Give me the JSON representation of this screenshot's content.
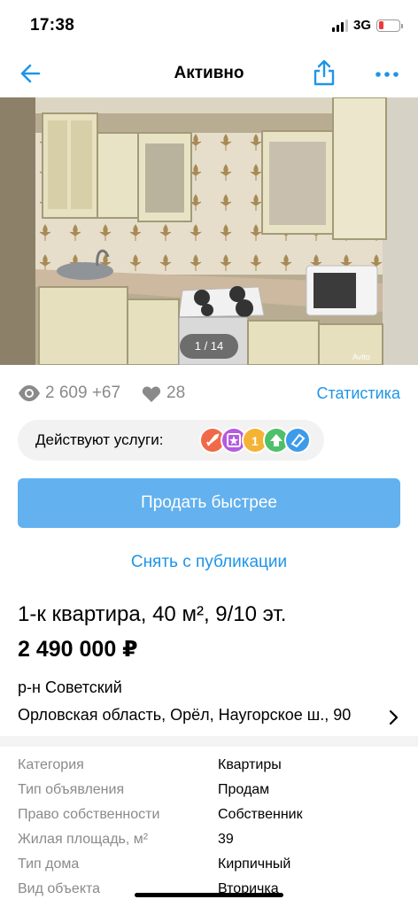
{
  "status": {
    "time": "17:38",
    "network": "3G",
    "battery_color": "#f0383e"
  },
  "nav": {
    "title": "Активно",
    "back_icon": "arrow-left-icon",
    "share_icon": "share-icon",
    "more_icon": "more-dots-icon"
  },
  "photo": {
    "counter": "1 / 14",
    "watermark": "Avito"
  },
  "stats": {
    "views": "2 609 +67",
    "likes": "28",
    "link_label": "Статистика"
  },
  "services": {
    "label": "Действуют услуги:",
    "icons": [
      "rocket-icon",
      "star-icon",
      "number-one-icon",
      "arrow-up-icon",
      "tag-icon"
    ]
  },
  "actions": {
    "sell_faster": "Продать быстрее",
    "unpublish": "Снять с публикации"
  },
  "listing": {
    "title": "1-к квартира, 40 м², 9/10 эт.",
    "price": "2 490 000 ₽",
    "district": "р-н Советский",
    "address": "Орловская область, Орёл, Наугорское ш., 90"
  },
  "params": [
    {
      "key": "Категория",
      "value": "Квартиры"
    },
    {
      "key": "Тип объявления",
      "value": "Продам"
    },
    {
      "key": "Право собственности",
      "value": "Собственник"
    },
    {
      "key": "Жилая площадь, м²",
      "value": "39"
    },
    {
      "key": "Тип дома",
      "value": "Кирпичный"
    },
    {
      "key": "Вид объекта",
      "value": "Вторичка"
    }
  ],
  "colors": {
    "accent": "#1e95e8",
    "primary_button": "#63b1ee"
  }
}
